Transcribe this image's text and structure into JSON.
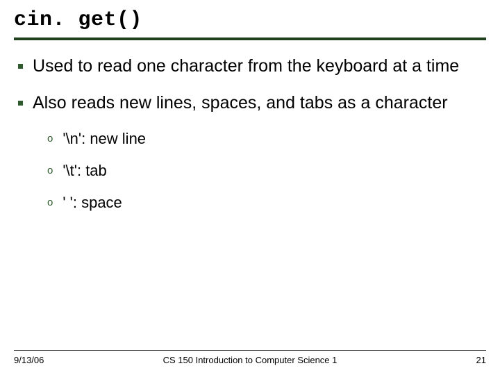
{
  "title": "cin. get()",
  "bullets": [
    {
      "text": "Used to read one character from the keyboard at a time"
    },
    {
      "text": "Also reads new lines, spaces, and tabs as a character"
    }
  ],
  "sub_bullets": [
    {
      "text": "'\\n': new line"
    },
    {
      "text": "'\\t': tab"
    },
    {
      "text": "' ': space"
    }
  ],
  "sub_marker": "o",
  "footer": {
    "date": "9/13/06",
    "course": "CS 150 Introduction to Computer Science 1",
    "page": "21"
  }
}
